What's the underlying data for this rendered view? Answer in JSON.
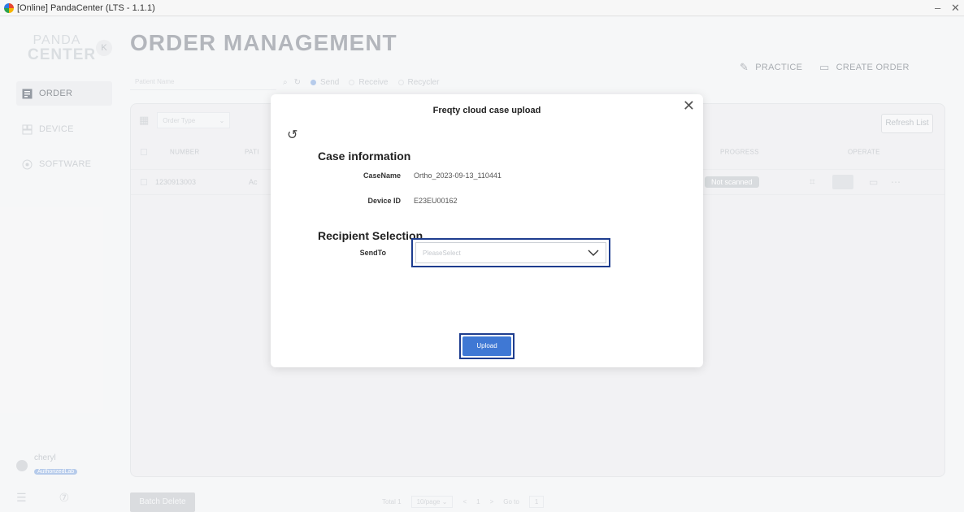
{
  "window": {
    "title": "[Online] PandaCenter (LTS - 1.1.1)",
    "minimize": "–",
    "close": "✕"
  },
  "sidebar": {
    "logo_line1": "PANDA",
    "logo_line2": "CENTER",
    "collapse_icon": "K",
    "items": [
      {
        "label": "ORDER",
        "icon": "order-icon",
        "active": true
      },
      {
        "label": "DEVICE",
        "icon": "device-icon",
        "active": false
      },
      {
        "label": "SOFTWARE",
        "icon": "software-icon",
        "active": false
      }
    ],
    "user": {
      "name": "cheryl",
      "badge": "AuthorizedLab"
    }
  },
  "header": {
    "title": "ORDER MANAGEMENT",
    "practice_label": "PRACTICE",
    "create_order_label": "CREATE ORDER"
  },
  "search": {
    "placeholder": "Patient Name",
    "options": [
      "Send",
      "Receive",
      "Recycler"
    ],
    "selected": "Send"
  },
  "table": {
    "order_type_placeholder": "Order Type",
    "refresh_label": "Refresh List",
    "columns": {
      "number": "NUMBER",
      "patient": "PATI",
      "progress": "PROGRESS",
      "operate": "OPERATE"
    },
    "rows": [
      {
        "number": "1230913003",
        "patient": "Ac",
        "progress": "Not scanned"
      }
    ]
  },
  "footer": {
    "batch_delete_label": "Batch Delete",
    "total_label": "Total 1",
    "page_size": "10/page",
    "prev": "<",
    "page": "1",
    "next": ">",
    "goto_label": "Go to",
    "goto_value": "1"
  },
  "modal": {
    "title": "Freqty cloud case upload",
    "close": "✕",
    "back": "↺",
    "case_section_title": "Case information",
    "case_name_label": "CaseName",
    "case_name_value": "Ortho_2023-09-13_110441",
    "device_id_label": "Device ID",
    "device_id_value": "E23EU00162",
    "recipient_section_title": "Recipient Selection",
    "send_to_label": "SendTo",
    "send_to_placeholder": "PleaseSelect",
    "upload_label": "Upload"
  },
  "colors": {
    "accent": "#3f78d4",
    "highlight_border": "#1e3d8f"
  }
}
